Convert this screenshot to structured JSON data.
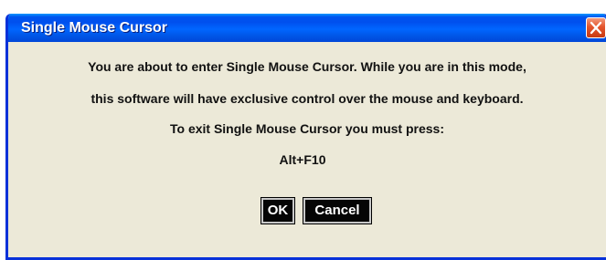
{
  "dialog": {
    "title": "Single Mouse Cursor",
    "message_line_1": "You are about to enter Single Mouse Cursor. While you are in this mode,",
    "message_line_2": "this software will have exclusive control over the mouse and keyboard.",
    "message_line_3": "To exit Single Mouse Cursor you must press:",
    "shortcut": "Alt+F10",
    "ok_label": "OK",
    "cancel_label": "Cancel",
    "close_icon": "close-icon"
  },
  "colors": {
    "titlebar": "#0055e5",
    "window_bg": "#ece9d8",
    "close_button": "#e4552d",
    "button_bg": "#050505",
    "button_text": "#ffffff"
  }
}
